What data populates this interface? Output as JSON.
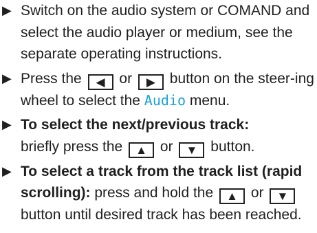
{
  "instructions": [
    {
      "marker": "▶",
      "text": "Switch on the audio system or COMAND and select the audio player or medium, see the separate operating instructions."
    },
    {
      "marker": "▶",
      "pre": "Press the",
      "key_left": "◀",
      "or_a": "or",
      "key_right": "▶",
      "mid": "button on the steer-ing wheel to select the",
      "menu_name": "Audio",
      "post": "menu."
    },
    {
      "marker": "▶",
      "heading": "To select the next/previous track:",
      "pre": "briefly press the",
      "key_up": "▲",
      "or_a": "or",
      "key_down": "▼",
      "post": "button."
    },
    {
      "marker": "▶",
      "heading": "To select a track from the track list (rapid scrolling):",
      "pre": "press and hold the",
      "key_up": "▲",
      "or_a": "or",
      "key_down": "▼",
      "post": "button until desired track has been reached."
    }
  ]
}
